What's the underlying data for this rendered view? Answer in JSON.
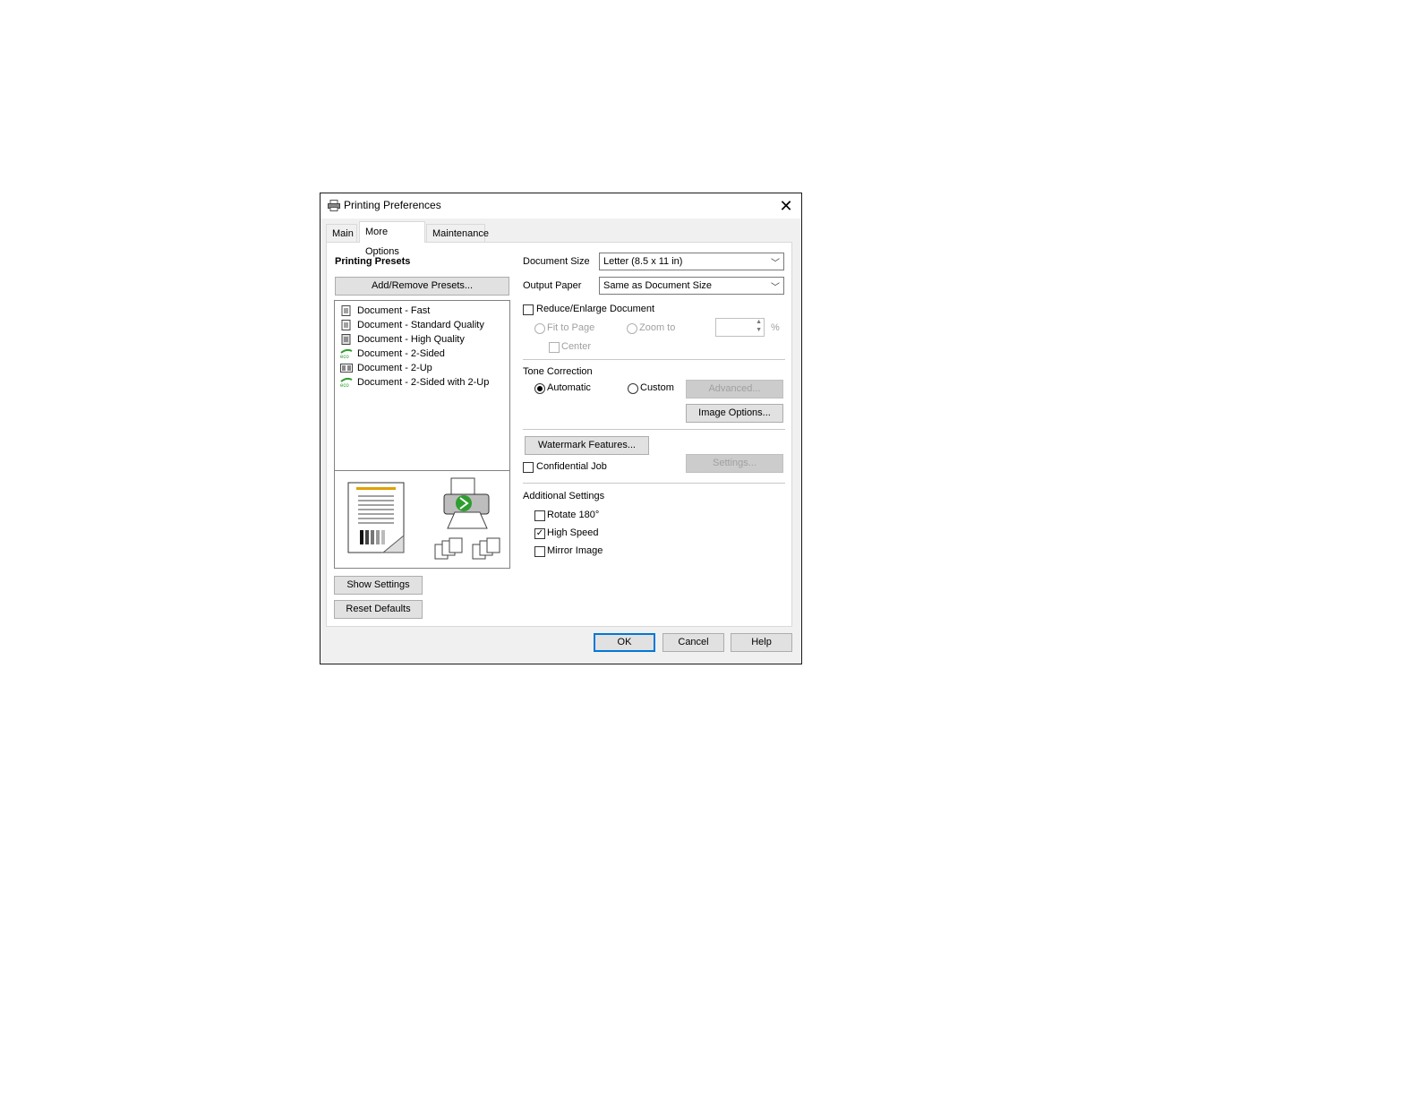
{
  "window": {
    "title": "Printing Preferences",
    "close_glyph": "✕"
  },
  "tabs": [
    {
      "label": "Main"
    },
    {
      "label": "More Options"
    },
    {
      "label": "Maintenance"
    }
  ],
  "presets": {
    "heading": "Printing Presets",
    "add_remove_label": "Add/Remove Presets...",
    "items": [
      {
        "label": "Document - Fast",
        "icon": "document-icon"
      },
      {
        "label": "Document - Standard Quality",
        "icon": "document-icon"
      },
      {
        "label": "Document - High Quality",
        "icon": "document-icon"
      },
      {
        "label": "Document - 2-Sided",
        "icon": "eco-icon"
      },
      {
        "label": "Document - 2-Up",
        "icon": "two-up-icon"
      },
      {
        "label": "Document - 2-Sided with 2-Up",
        "icon": "eco-icon"
      }
    ],
    "show_settings_label": "Show Settings",
    "reset_defaults_label": "Reset Defaults"
  },
  "document_size": {
    "label": "Document Size",
    "value": "Letter (8.5 x 11 in)"
  },
  "output_paper": {
    "label": "Output Paper",
    "value": "Same as Document Size"
  },
  "reduce_enlarge": {
    "label": "Reduce/Enlarge Document",
    "checked": false,
    "fit_to_page_label": "Fit to Page",
    "zoom_to_label": "Zoom to",
    "percent_symbol": "%",
    "center_label": "Center"
  },
  "tone_correction": {
    "label": "Tone Correction",
    "automatic_label": "Automatic",
    "custom_label": "Custom",
    "selected": "Automatic",
    "advanced_label": "Advanced...",
    "image_options_label": "Image Options..."
  },
  "watermark": {
    "button_label": "Watermark Features...",
    "confidential_label": "Confidential Job",
    "settings_label": "Settings..."
  },
  "additional": {
    "label": "Additional Settings",
    "rotate_label": "Rotate 180°",
    "rotate_checked": false,
    "high_speed_label": "High Speed",
    "high_speed_checked": true,
    "mirror_label": "Mirror Image",
    "mirror_checked": false
  },
  "footer": {
    "ok_label": "OK",
    "cancel_label": "Cancel",
    "help_label": "Help"
  },
  "colors": {
    "accent": "#0078d7",
    "eco_green": "#2e9e2e"
  }
}
